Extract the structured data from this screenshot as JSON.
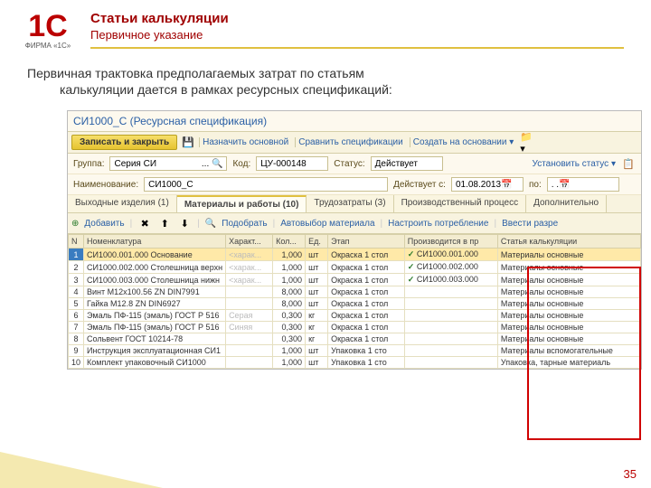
{
  "slide": {
    "title": "Статьи калькуляции",
    "subtitle": "Первичное указание",
    "intro_l1": "Первичная трактовка предполагаемых затрат по статьям",
    "intro_l2": "калькуляции дается в рамках ресурсных спецификаций:",
    "pagenum": "35"
  },
  "logo": {
    "big": "1C",
    "sub": "ФИРМА «1С»"
  },
  "win": {
    "title": "СИ1000_С (Ресурсная спецификация)",
    "save": "Записать и закрыть",
    "tool1": "Назначить основной",
    "tool2": "Сравнить спецификации",
    "tool3": "Создать на основании",
    "group_lbl": "Группа:",
    "group_val": "Серия СИ",
    "code_lbl": "Код:",
    "code_val": "ЦУ-000148",
    "status_lbl": "Статус:",
    "status_val": "Действует",
    "setstatus": "Установить статус",
    "name_lbl": "Наименование:",
    "name_val": "СИ1000_С",
    "valid_lbl": "Действует с:",
    "valid_val": "01.08.2013",
    "to_lbl": "по:",
    "to_val": ". .",
    "tabs": [
      "Выходные изделия (1)",
      "Материалы и работы (10)",
      "Трудозатраты (3)",
      "Производственный процесс",
      "Дополнительно"
    ],
    "sub_add": "Добавить",
    "sub_pick": "Подобрать",
    "sub_auto": "Автовыбор материала",
    "sub_cons": "Настроить потребление",
    "sub_enter": "Ввести разре",
    "cols": [
      "N",
      "Номенклатура",
      "Характ...",
      "Кол...",
      "Ед.",
      "Этап",
      "Производится в пр",
      "Статья калькуляции"
    ]
  },
  "rows": [
    {
      "n": "1",
      "nom": "СИ1000.001.000 Основание",
      "ch": "<харак...",
      "q": "1,000",
      "u": "шт",
      "stage": "Окраска 1 стол",
      "prod": "СИ1000.001.000",
      "chk": true,
      "art": "Материалы основные"
    },
    {
      "n": "2",
      "nom": "СИ1000.002.000 Столешница верхн",
      "ch": "<харак...",
      "q": "1,000",
      "u": "шт",
      "stage": "Окраска 1 стол",
      "prod": "СИ1000.002.000",
      "chk": true,
      "art": "Материалы основные"
    },
    {
      "n": "3",
      "nom": "СИ1000.003.000 Столешница нижн",
      "ch": "<харак...",
      "q": "1,000",
      "u": "шт",
      "stage": "Окраска 1 стол",
      "prod": "СИ1000.003.000",
      "chk": true,
      "art": "Материалы основные"
    },
    {
      "n": "4",
      "nom": "Винт М12х100.56 ZN DIN7991",
      "ch": "",
      "q": "8,000",
      "u": "шт",
      "stage": "Окраска 1 стол",
      "prod": "",
      "chk": false,
      "art": "Материалы основные"
    },
    {
      "n": "5",
      "nom": "Гайка М12.8 ZN DIN6927",
      "ch": "",
      "q": "8,000",
      "u": "шт",
      "stage": "Окраска 1 стол",
      "prod": "",
      "chk": false,
      "art": "Материалы основные"
    },
    {
      "n": "6",
      "nom": "Эмаль ПФ-115 (эмаль) ГОСТ Р 516",
      "ch": "Серая",
      "q": "0,300",
      "u": "кг",
      "stage": "Окраска 1 стол",
      "prod": "",
      "chk": false,
      "art": "Материалы основные"
    },
    {
      "n": "7",
      "nom": "Эмаль ПФ-115 (эмаль) ГОСТ Р 516",
      "ch": "Синяя",
      "q": "0,300",
      "u": "кг",
      "stage": "Окраска 1 стол",
      "prod": "",
      "chk": false,
      "art": "Материалы основные"
    },
    {
      "n": "8",
      "nom": "Сольвент ГОСТ 10214-78",
      "ch": "",
      "q": "0,300",
      "u": "кг",
      "stage": "Окраска 1 стол",
      "prod": "",
      "chk": false,
      "art": "Материалы основные"
    },
    {
      "n": "9",
      "nom": "Инструкция эксплуатационная СИ1",
      "ch": "",
      "q": "1,000",
      "u": "шт",
      "stage": "Упаковка 1 сто",
      "prod": "",
      "chk": false,
      "art": "Материалы вспомогательные"
    },
    {
      "n": "10",
      "nom": "Комплект упаковочный СИ1000",
      "ch": "",
      "q": "1,000",
      "u": "шт",
      "stage": "Упаковка 1 сто",
      "prod": "",
      "chk": false,
      "art": "Упаковка, тарные материаль"
    }
  ]
}
